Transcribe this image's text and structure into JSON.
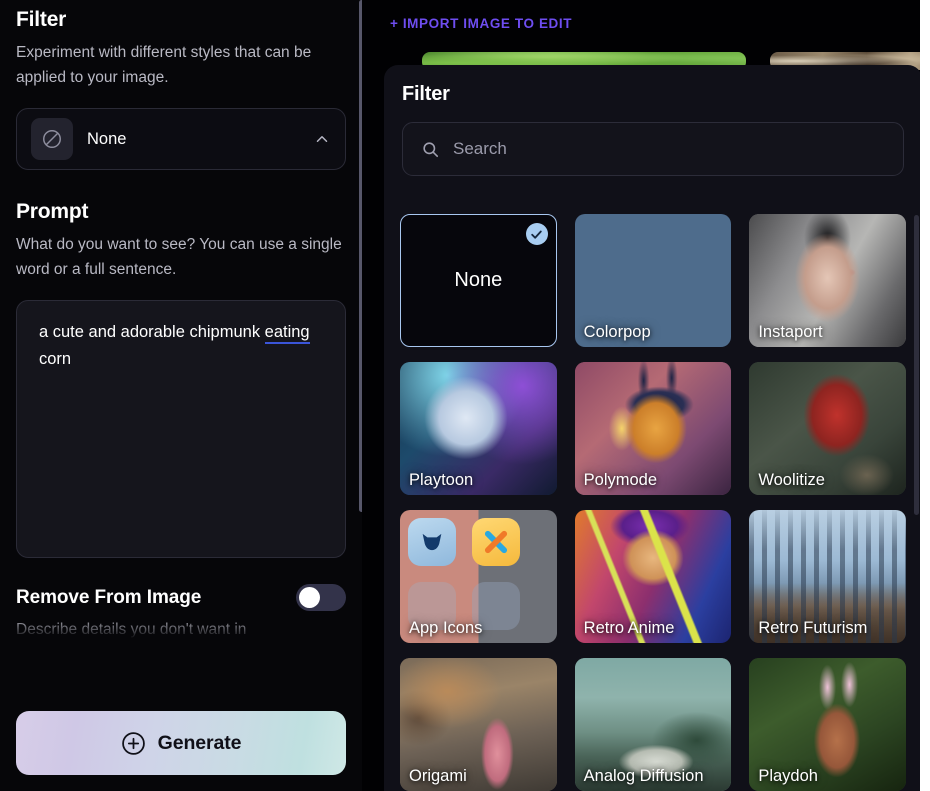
{
  "left_panel": {
    "filter": {
      "title": "Filter",
      "description": "Experiment with different styles that can be applied to your image.",
      "selected_value": "None",
      "icon": "prohibition-icon",
      "chevron": "chevron-up-icon"
    },
    "prompt": {
      "title": "Prompt",
      "description": "What do you want to see? You can use a single word or a full sentence.",
      "value_part1": "a cute and adorable chipmunk ",
      "value_misspelled": "eating",
      "value_part2": " corn"
    },
    "remove_from_image": {
      "title": "Remove From Image",
      "description": "Describe details you don't want in",
      "toggle_state": "off"
    },
    "generate": {
      "label": "Generate",
      "icon": "plus-circle-icon"
    }
  },
  "workspace": {
    "import_link": "+ IMPORT IMAGE TO EDIT"
  },
  "modal": {
    "title": "Filter",
    "search": {
      "placeholder": "Search",
      "value": "",
      "icon": "search-icon"
    },
    "cards": [
      {
        "label": "None",
        "art": "art-none",
        "selected": true,
        "badge": "check-icon"
      },
      {
        "label": "Colorpop",
        "art": "art-colorpop",
        "selected": false
      },
      {
        "label": "Instaport",
        "art": "art-instaport",
        "selected": false
      },
      {
        "label": "Playtoon",
        "art": "art-playtoon",
        "selected": false
      },
      {
        "label": "Polymode",
        "art": "art-polymode",
        "selected": false
      },
      {
        "label": "Woolitize",
        "art": "art-woolitize",
        "selected": false
      },
      {
        "label": "App Icons",
        "art": "art-appicons",
        "selected": false
      },
      {
        "label": "Retro Anime",
        "art": "art-retroanime",
        "selected": false
      },
      {
        "label": "Retro Futurism",
        "art": "art-retrofuturism",
        "selected": false
      },
      {
        "label": "Origami",
        "art": "art-origami",
        "selected": false
      },
      {
        "label": "Analog Diffusion",
        "art": "art-analog",
        "selected": false
      },
      {
        "label": "Playdoh",
        "art": "art-playdoh",
        "selected": false
      }
    ]
  },
  "colors": {
    "accent_purple": "#6e4df0",
    "selection_blue": "#a8c7f0",
    "badge_blue": "#a8cdf2",
    "panel_bg": "#101018",
    "app_bg": "#060609",
    "text_primary": "#ffffff",
    "text_secondary": "#b9b9c4",
    "spellcheck_underline": "#3b55d9"
  }
}
